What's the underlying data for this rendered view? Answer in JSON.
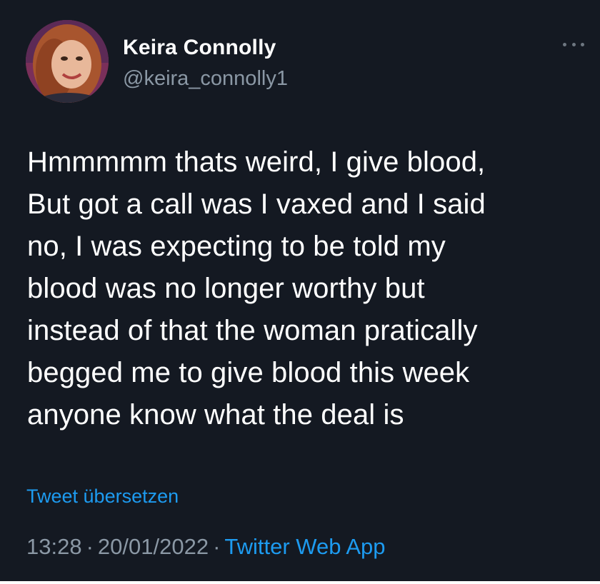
{
  "author": {
    "name": "Keira Connolly",
    "handle": "@keira_connolly1"
  },
  "tweet": {
    "lines": [
      "Hmmmmm thats weird, I give blood,",
      "But got a call was I vaxed and I said",
      "no, I was expecting to be told my",
      "blood was no longer worthy but",
      "instead of that the woman pratically",
      "begged me to give blood this week",
      "anyone know what the deal is"
    ],
    "translate_label": "Tweet übersetzen"
  },
  "meta": {
    "time": "13:28",
    "separator": "·",
    "date": "20/01/2022",
    "source": "Twitter Web App"
  },
  "icons": {
    "more": "more-horizontal-icon"
  },
  "colors": {
    "background": "#141922",
    "accent": "#1d9bf0",
    "secondary_text": "#8b98a5"
  }
}
